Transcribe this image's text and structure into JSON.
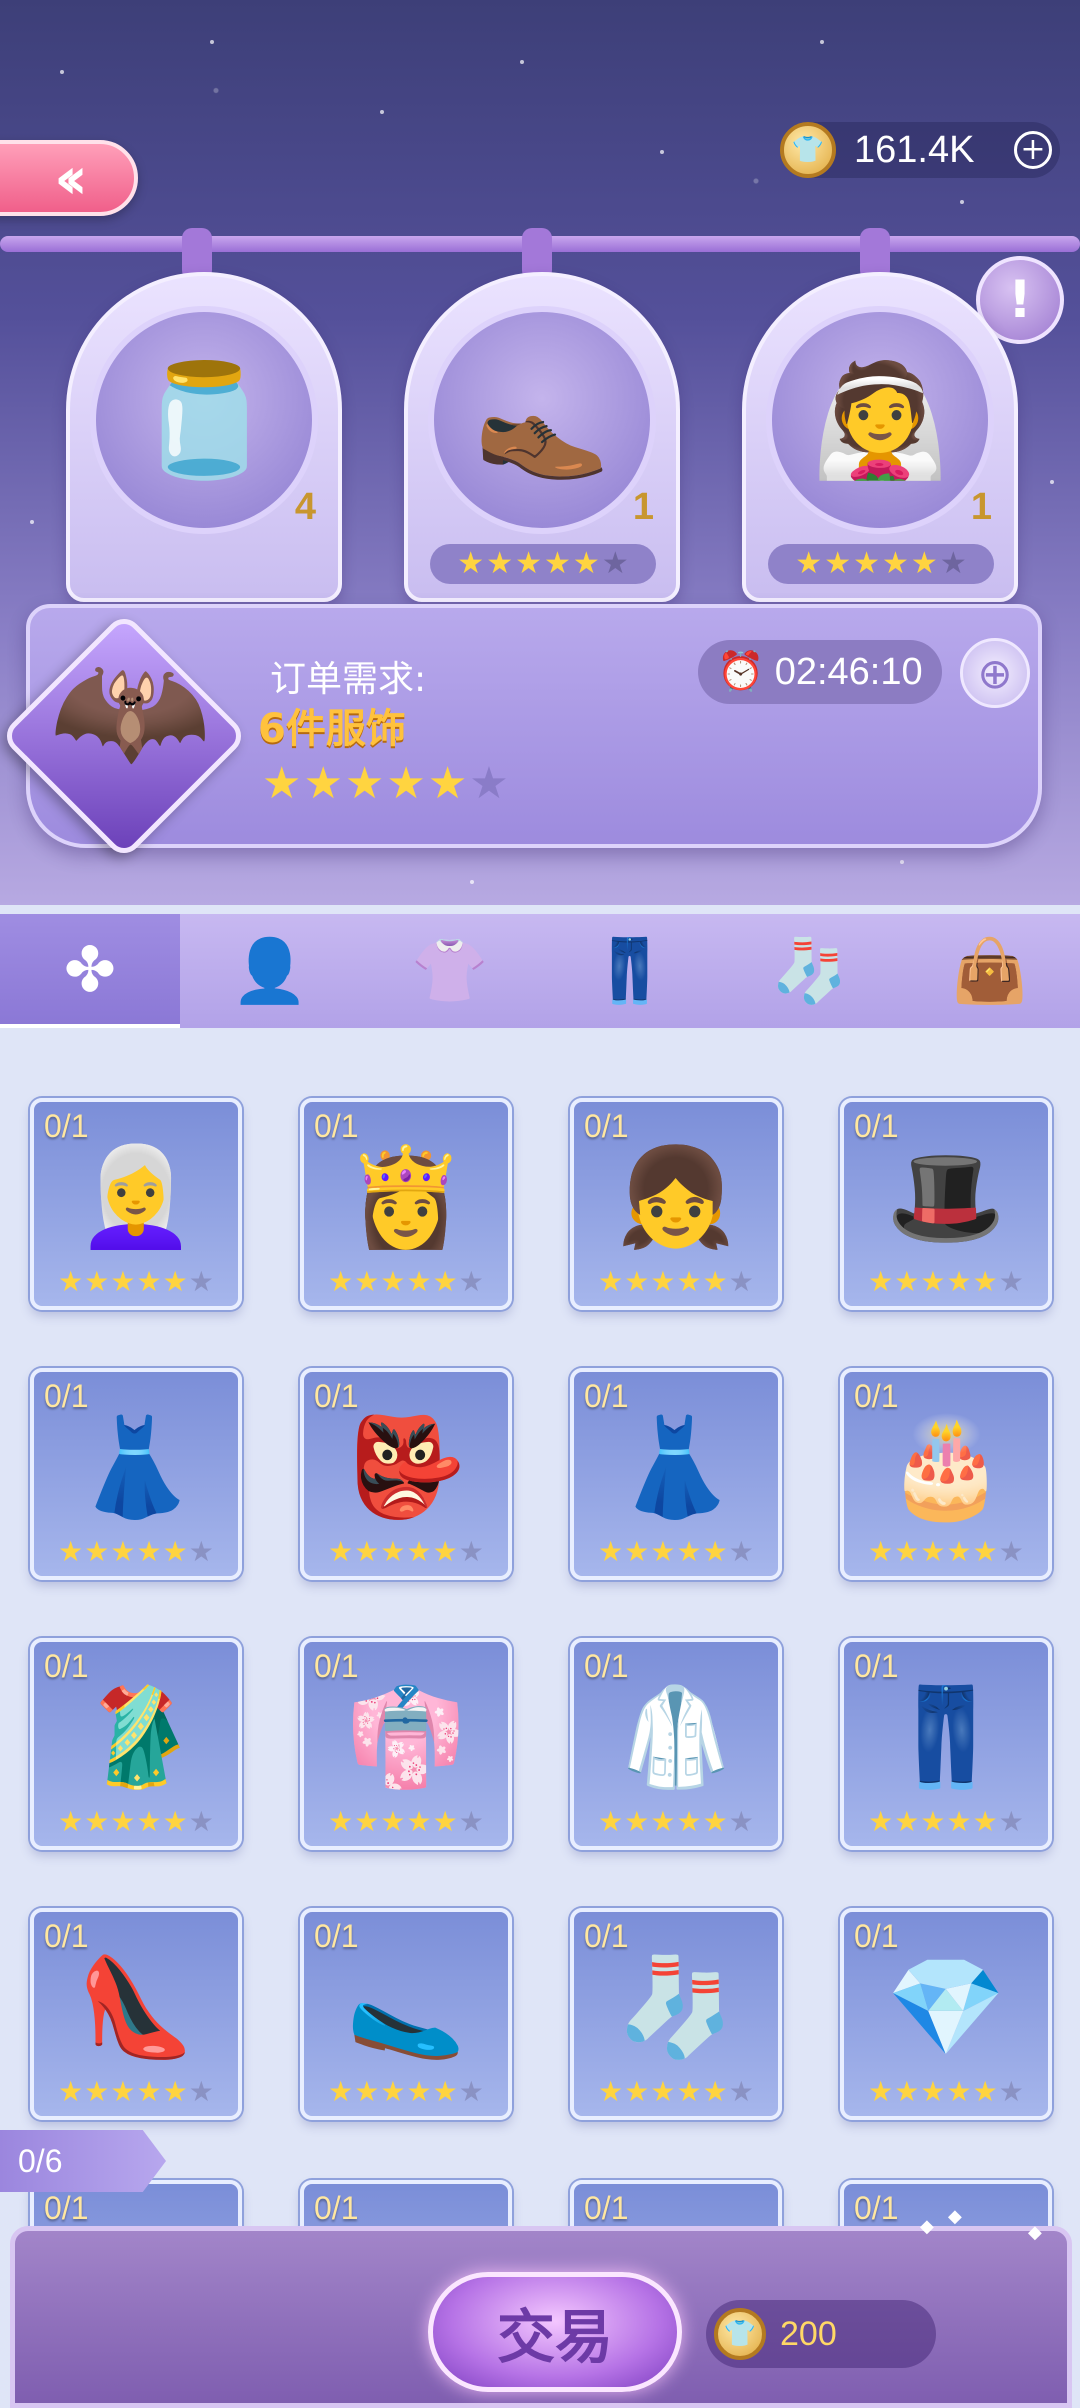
{
  "header": {
    "back_icon": "double-chevron-left-icon",
    "currency": {
      "icon": "shirt-coin-icon",
      "value": "161.4K"
    }
  },
  "requirements": [
    {
      "icon": "star-bottle-icon",
      "count": "4",
      "stars": 0,
      "show_stars": false
    },
    {
      "icon": "feather-shoes-icon",
      "count": "1",
      "stars": 5,
      "show_stars": true
    },
    {
      "icon": "veil-hair-icon",
      "count": "1",
      "stars": 5,
      "show_stars": true
    }
  ],
  "order": {
    "label": "订单需求:",
    "value": "6件服饰",
    "stars": 5,
    "max_stars": 6,
    "timer": "02:46:10",
    "client_icon": "bat-character-icon"
  },
  "tabs": [
    {
      "icon": "clover-icon",
      "active": true
    },
    {
      "icon": "hair-icon",
      "active": false
    },
    {
      "icon": "top-icon",
      "active": false
    },
    {
      "icon": "pants-icon",
      "active": false
    },
    {
      "icon": "sock-icon",
      "active": false
    },
    {
      "icon": "bag-accessory-icon",
      "active": false
    }
  ],
  "items": [
    {
      "count": "0/1",
      "icon": "white-curly-wig-icon",
      "art": "👩‍🦳",
      "stars": 5
    },
    {
      "count": "0/1",
      "icon": "crown-hair-icon",
      "art": "👸",
      "stars": 5
    },
    {
      "count": "0/1",
      "icon": "braided-hair-icon",
      "art": "👧",
      "stars": 5
    },
    {
      "count": "0/1",
      "icon": "black-hat-icon",
      "art": "🎩",
      "stars": 5
    },
    {
      "count": "0/1",
      "icon": "white-dress-icon",
      "art": "👗",
      "stars": 5
    },
    {
      "count": "0/1",
      "icon": "red-mask-icon",
      "art": "👺",
      "stars": 5
    },
    {
      "count": "0/1",
      "icon": "pink-gown-icon",
      "art": "👗",
      "stars": 5
    },
    {
      "count": "0/1",
      "icon": "pink-cake-dress-icon",
      "art": "🎂",
      "stars": 5
    },
    {
      "count": "0/1",
      "icon": "brown-robe-icon",
      "art": "🥻",
      "stars": 5
    },
    {
      "count": "0/1",
      "icon": "cream-robe-icon",
      "art": "👘",
      "stars": 5
    },
    {
      "count": "0/1",
      "icon": "white-outfit-icon",
      "art": "🥼",
      "stars": 5
    },
    {
      "count": "0/1",
      "icon": "brown-skirt-icon",
      "art": "👖",
      "stars": 5
    },
    {
      "count": "0/1",
      "icon": "green-heels-icon",
      "art": "👠",
      "stars": 5
    },
    {
      "count": "0/1",
      "icon": "pink-flats-icon",
      "art": "🥿",
      "stars": 5
    },
    {
      "count": "0/1",
      "icon": "dark-stockings-icon",
      "art": "🧦",
      "stars": 5
    },
    {
      "count": "0/1",
      "icon": "gem-bracelet-icon",
      "art": "💎",
      "stars": 5
    },
    {
      "count": "0/1",
      "icon": "pearl-necklace-icon",
      "art": "",
      "stars": 0
    },
    {
      "count": "0/1",
      "icon": "pearl-chain-icon",
      "art": "",
      "stars": 0
    },
    {
      "count": "0/1",
      "icon": "dark-ring-icon",
      "art": "",
      "stars": 0
    },
    {
      "count": "0/1",
      "icon": "sparkle-item-icon",
      "art": "",
      "stars": 0
    }
  ],
  "progress": "0/6",
  "footer": {
    "trade_label": "交易",
    "cost": "200",
    "cost_icon": "shirt-coin-icon"
  }
}
